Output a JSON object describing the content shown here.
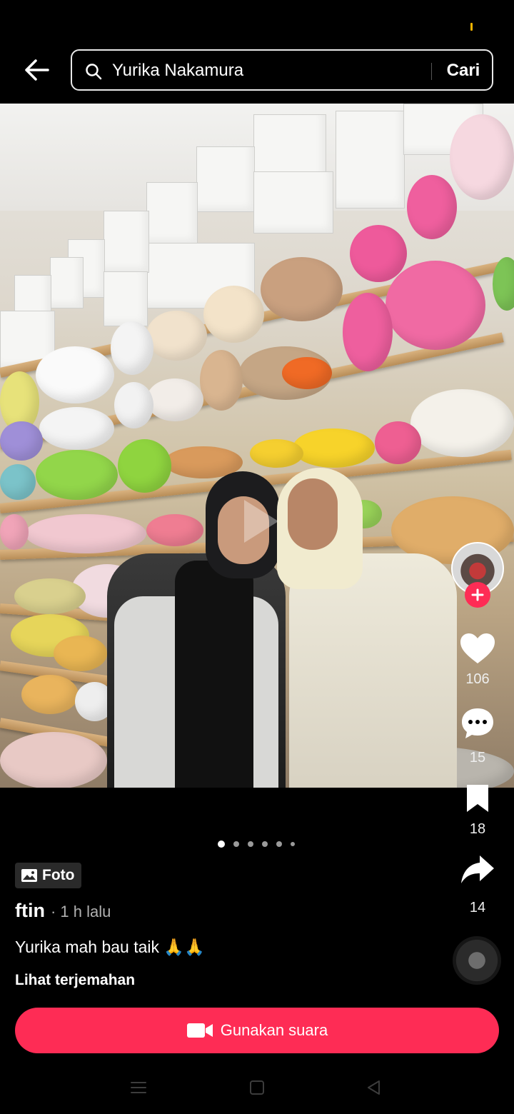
{
  "search": {
    "query": "Yurika Nakamura",
    "button": "Cari"
  },
  "post": {
    "type_badge": "Foto",
    "author": "ftin",
    "time": "· 1 h lalu",
    "caption": "Yurika mah bau taik 🙏🙏",
    "translate": "Lihat terjemahan",
    "use_sound": "Gunakan suara",
    "carousel": {
      "total": 6,
      "active": 1
    }
  },
  "actions": {
    "likes": "106",
    "comments": "15",
    "saves": "18",
    "shares": "14"
  },
  "colors": {
    "accent": "#fe2c55",
    "background": "#000000",
    "status_mark": "#f5b400"
  },
  "icons": [
    "back-arrow-icon",
    "search-icon",
    "play-icon",
    "plus-icon",
    "heart-icon",
    "comment-icon",
    "bookmark-icon",
    "share-icon",
    "photo-icon",
    "video-camera-icon",
    "menu-icon",
    "home-square-icon",
    "back-triangle-icon"
  ]
}
